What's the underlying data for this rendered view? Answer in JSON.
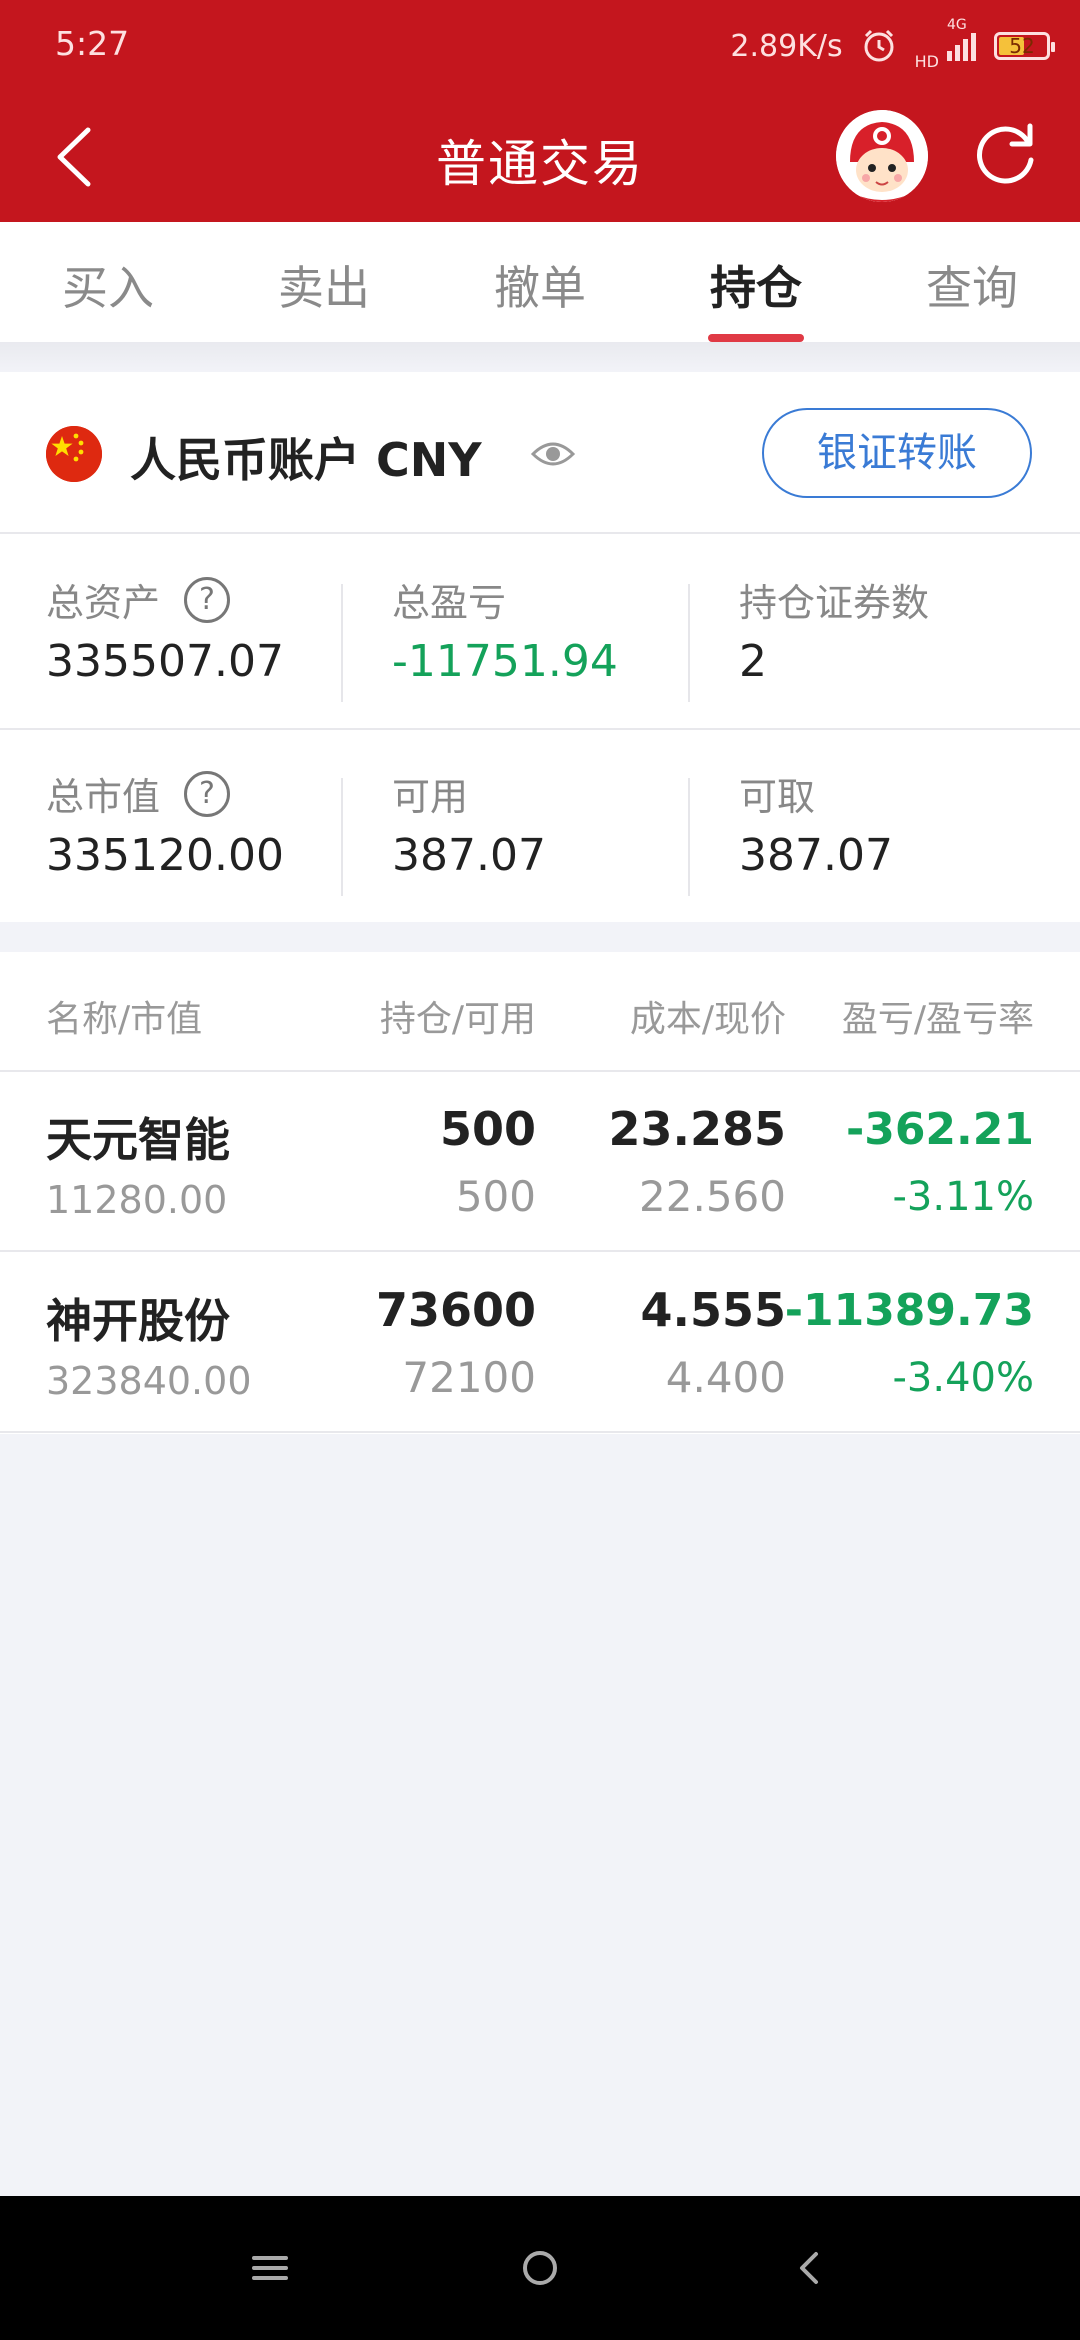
{
  "status_bar": {
    "time": "5:27",
    "net_speed": "2.89K/s",
    "network": "4G",
    "hd": "HD",
    "battery": "52"
  },
  "nav": {
    "title": "普通交易"
  },
  "tabs": [
    {
      "label": "买入"
    },
    {
      "label": "卖出"
    },
    {
      "label": "撤单"
    },
    {
      "label": "持仓",
      "active": true
    },
    {
      "label": "查询"
    }
  ],
  "account": {
    "name": "人民币账户 CNY",
    "transfer_label": "银证转账",
    "total_assets_label": "总资产",
    "total_assets": "335507.07",
    "total_pl_label": "总盈亏",
    "total_pl": "-11751.94",
    "holding_count_label": "持仓证券数",
    "holding_count": "2",
    "market_value_label": "总市值",
    "market_value": "335120.00",
    "available_label": "可用",
    "available": "387.07",
    "withdrawable_label": "可取",
    "withdrawable": "387.07"
  },
  "holdings": {
    "columns": [
      "名称/市值",
      "持仓/可用",
      "成本/现价",
      "盈亏/盈亏率"
    ],
    "rows": [
      {
        "name": "天元智能",
        "market_value": "11280.00",
        "position": "500",
        "available": "500",
        "cost": "23.285",
        "price": "22.560",
        "pl": "-362.21",
        "pl_rate": "-3.11%"
      },
      {
        "name": "神开股份",
        "market_value": "323840.00",
        "position": "73600",
        "available": "72100",
        "cost": "4.555",
        "price": "4.400",
        "pl": "-11389.73",
        "pl_rate": "-3.40%"
      }
    ]
  },
  "colors": {
    "brand_red": "#c4161e",
    "loss_green": "#14a25a",
    "link_blue": "#3a7bd5",
    "tab_indicator": "#e03a45"
  }
}
